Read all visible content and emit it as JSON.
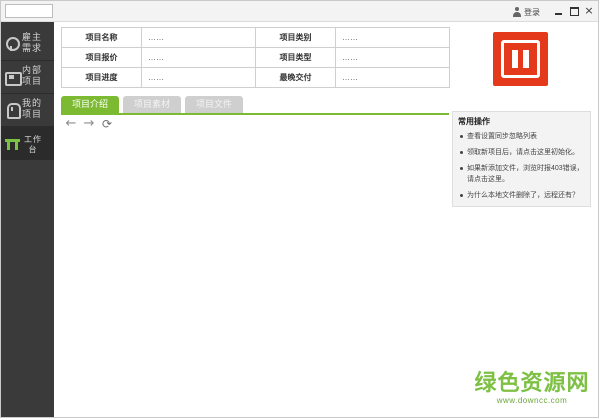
{
  "titlebar": {
    "login_label": "登录",
    "close_glyph": "×"
  },
  "sidebar": {
    "items": [
      {
        "label": "雇主需求",
        "icon": "employer-icon"
      },
      {
        "label": "内部项目",
        "icon": "internal-project-icon"
      },
      {
        "label": "我的项目",
        "icon": "my-project-icon"
      },
      {
        "label": "工作台",
        "icon": "workbench-icon",
        "active": true
      }
    ]
  },
  "info": {
    "rows": [
      {
        "k1": "项目名称",
        "v1": "……",
        "k2": "项目类别",
        "v2": "……"
      },
      {
        "k1": "项目报价",
        "v1": "……",
        "k2": "项目类型",
        "v2": "……"
      },
      {
        "k1": "项目进度",
        "v1": "……",
        "k2": "最晚交付",
        "v2": "……"
      }
    ]
  },
  "logo": {
    "icon": "pause-logo-icon",
    "color": "#e5391c"
  },
  "tabs": [
    {
      "label": "项目介绍",
      "active": true
    },
    {
      "label": "项目素材"
    },
    {
      "label": "项目文件"
    }
  ],
  "toolbar": {
    "back_glyph": "←",
    "forward_glyph": "→",
    "refresh_glyph": "⟳"
  },
  "panel": {
    "title": "常用操作",
    "items": [
      "查看设置同步忽略列表",
      "领取新项目后，请点击这里初始化。",
      "如果新添加文件，浏览时报403错误，请点击这里。",
      "为什么本地文件删除了，远程还有？"
    ]
  },
  "watermark": {
    "brand": "绿色资源网",
    "url": "www.downcc.com"
  },
  "colors": {
    "accent_green": "#7cbb31",
    "sidebar_bg": "#3a3a3a",
    "logo_red": "#e5391c"
  }
}
